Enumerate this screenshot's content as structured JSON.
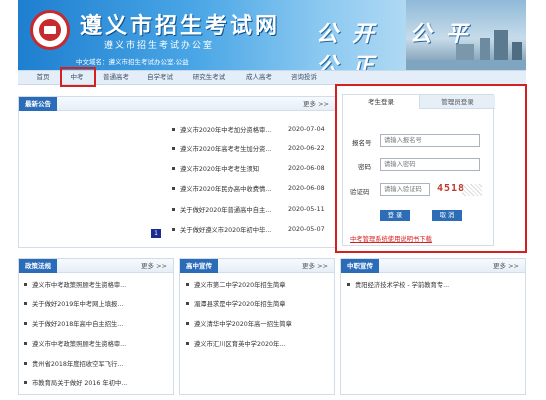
{
  "header": {
    "site_title": "遵义市招生考试网",
    "site_subtitle": "遵义市招生考试办公室",
    "domain_line": "中文域名：遵义市招生考试办公室.公益",
    "slogan": "公开 公平 公正"
  },
  "nav": {
    "items": [
      {
        "label": "首页"
      },
      {
        "label": "中考"
      },
      {
        "label": "普通高考"
      },
      {
        "label": "自学考试"
      },
      {
        "label": "研究生考试"
      },
      {
        "label": "成人高考"
      },
      {
        "label": "咨询投诉"
      }
    ]
  },
  "news": {
    "title": "最新公告",
    "more": "更多 >>",
    "items": [
      {
        "text": "遵义市2020年中考加分资格审...",
        "date": "2020-07-04"
      },
      {
        "text": "遵义市2020年高考考生加分资...",
        "date": "2020-06-22"
      },
      {
        "text": "遵义市2020年中考考生须知",
        "date": "2020-06-08"
      },
      {
        "text": "遵义市2020年民办高中收费情...",
        "date": "2020-06-08"
      },
      {
        "text": "关于做好2020年普通高中自主...",
        "date": "2020-05-11"
      },
      {
        "text": "关于做好遵义市2020年初中毕...",
        "date": "2020-05-07"
      }
    ],
    "page_number": "1"
  },
  "login": {
    "tab_student": "考生登录",
    "tab_admin": "管理员登录",
    "label_id": "报名号",
    "placeholder_id": "请输入报名号",
    "label_password": "密码",
    "placeholder_password": "请输入密码",
    "label_captcha": "验证码",
    "placeholder_captcha": "请输入验证码",
    "captcha_text": "4518",
    "login_button": "登 录",
    "cancel_button": "取 消",
    "manual_link": "中考管理系统使用说明书下载"
  },
  "policy": {
    "title": "政策法规",
    "more": "更多 >>",
    "items": [
      "遵义市中考政策照顾考生资格审...",
      "关于做好2019年中考网上填报...",
      "关于做好2018年高中自主招生...",
      "遵义市中考政策照顾考生资格审...",
      "贵州省2018年度招收空军飞行...",
      "市教育局关于做好 2016 年初中..."
    ]
  },
  "highschool": {
    "title": "高中宣传",
    "more": "更多 >>",
    "items": [
      "遵义市第二中学2020年招生简章",
      "湄潭县求是中学2020年招生简章",
      "遵义清华中学2020年高一招生简章",
      "遵义市汇川区育英中学2020年..."
    ]
  },
  "vocational": {
    "title": "中职宣传",
    "more": "更多 >>",
    "items": [
      "贵阳经济技术学校 - 学前教育专..."
    ]
  },
  "colors": {
    "primary": "#2b6cb8",
    "highlight": "#d52020",
    "nav_bg": "#e4eef8"
  }
}
